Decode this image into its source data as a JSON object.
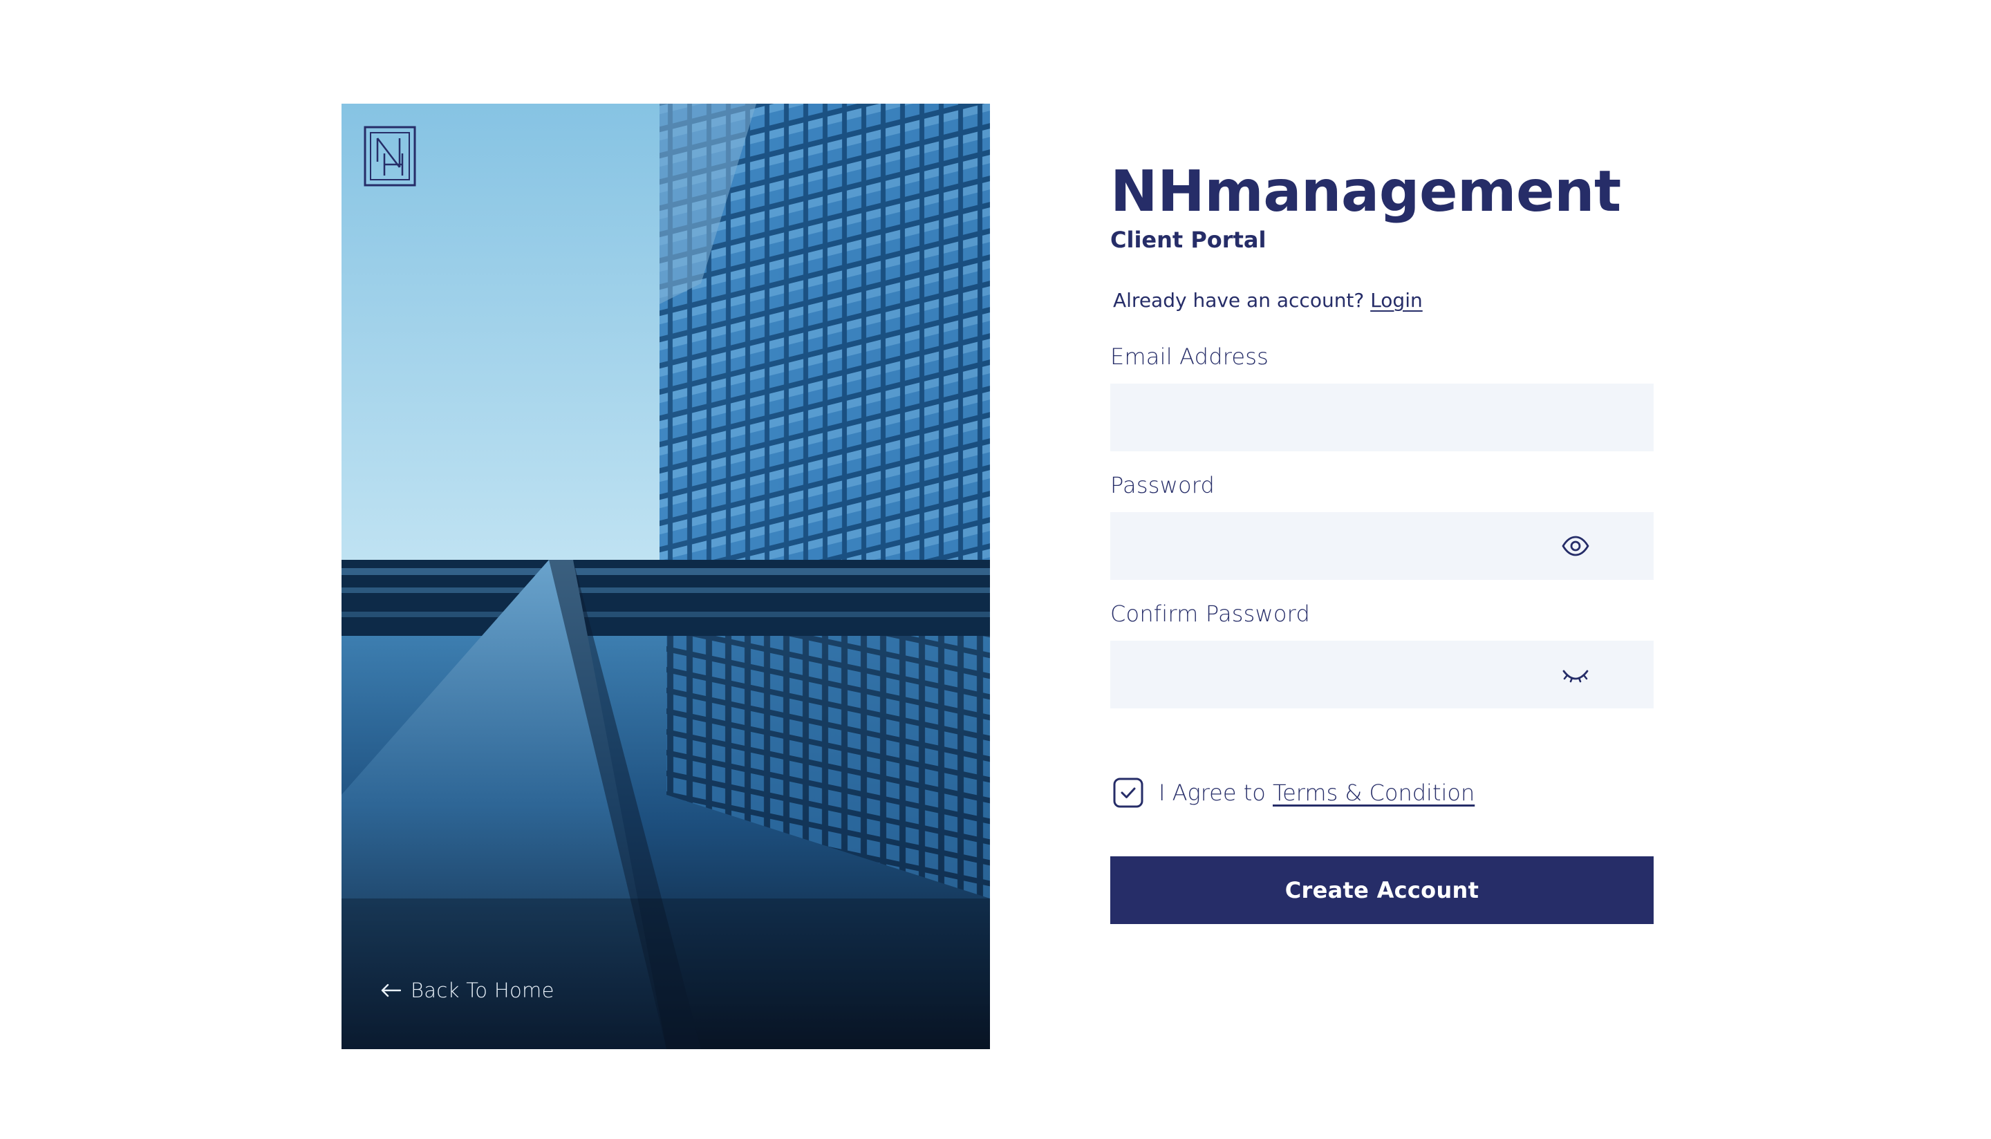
{
  "hero": {
    "logo_letters": "NH",
    "back_label": "Back To Home",
    "image_subject": "low-angle view of a glass skyscraper reflected in water"
  },
  "form": {
    "brand": "NHmanagement",
    "subtitle": "Client Portal",
    "have_account_text": "Already have an account?",
    "login_link": "Login",
    "email_label": "Email Address",
    "email_value": "",
    "password_label": "Password",
    "password_value": "",
    "password_toggle_icon": "eye-icon",
    "confirm_label": "Confirm Password",
    "confirm_value": "",
    "confirm_toggle_icon": "eye-closed-icon",
    "agree_text": "I Agree to",
    "terms_link": "Terms & Condition",
    "agree_checked": true,
    "submit_label": "Create Account"
  },
  "colors": {
    "brand": "#262d68",
    "input_bg": "#f2f5fa",
    "page_bg": "#ffffff"
  }
}
